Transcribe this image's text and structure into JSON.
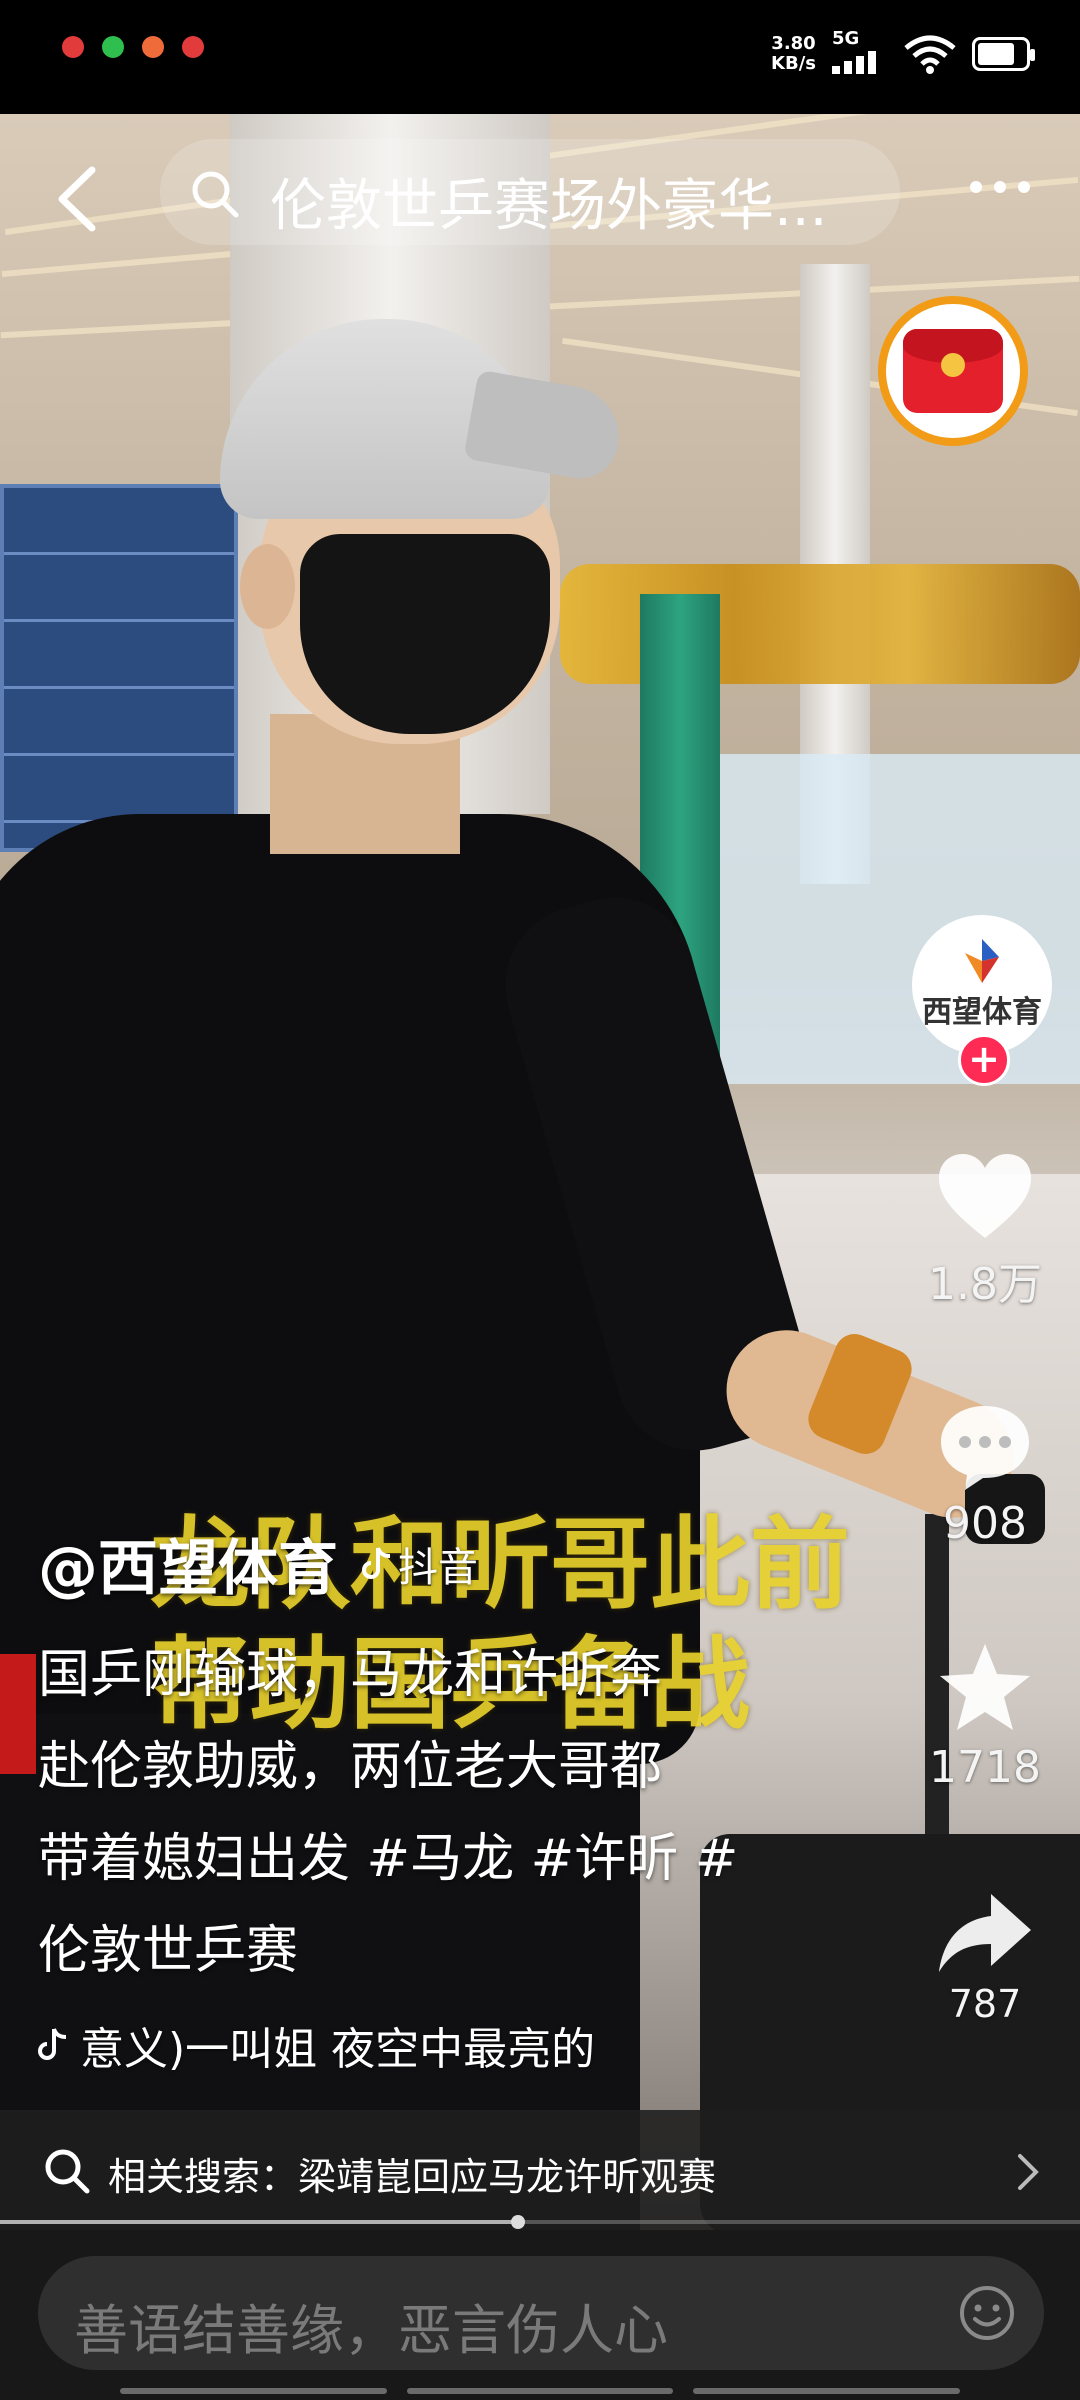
{
  "status_bar": {
    "net_speed_value": "3.80",
    "net_speed_unit": "KB/s",
    "network": "5G",
    "notification_dot_colors": [
      "#e23b3b",
      "#2fbf4e",
      "#ef6b3a",
      "#e23b3b"
    ]
  },
  "top_bar": {
    "search_text": "伦敦世乒赛场外豪华..."
  },
  "video": {
    "overlay_line1": "龙队和昕哥此前",
    "overlay_line2": "帮助国乒备战"
  },
  "side_actions": {
    "avatar_label": "西望体育",
    "like_count": "1.8万",
    "comment_count": "908",
    "favorite_count": "1718",
    "share_count": "787"
  },
  "caption": {
    "author": "@西望体育",
    "platform_badge": "抖音",
    "desc_line1": "国乒刚输球，马龙和许昕奔",
    "desc_line2": "赴伦敦助威，两位老大哥都",
    "desc_line3": "带着媳妇出发 #马龙 #许昕 #",
    "desc_line4": "伦敦世乒赛",
    "music": "意义)一叫姐    夜空中最亮的"
  },
  "related_search": {
    "text": "相关搜索：梁靖崑回应马龙许昕观赛"
  },
  "playback": {
    "progress_fraction": 0.48
  },
  "comment_bar": {
    "placeholder": "善语结善缘，恶言伤人心"
  },
  "colors": {
    "accent_red": "#fe2c55",
    "overlay_yellow": "#e8d12c",
    "redpacket_ring": "#f29b16"
  }
}
